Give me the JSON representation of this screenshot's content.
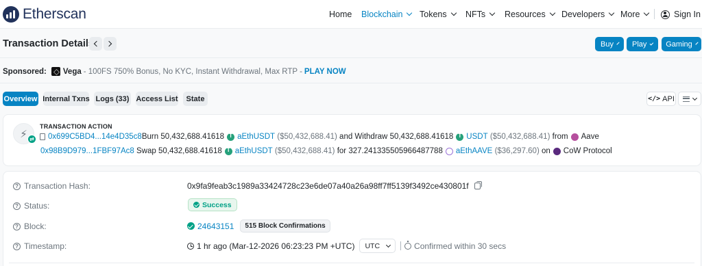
{
  "header": {
    "brand": "Etherscan",
    "nav": [
      {
        "label": "Home",
        "active": false,
        "dropdown": false
      },
      {
        "label": "Blockchain",
        "active": true,
        "dropdown": true
      },
      {
        "label": "Tokens",
        "active": false,
        "dropdown": true
      },
      {
        "label": "NFTs",
        "active": false,
        "dropdown": true
      },
      {
        "label": "Resources",
        "active": false,
        "dropdown": true
      },
      {
        "label": "Developers",
        "active": false,
        "dropdown": true
      },
      {
        "label": "More",
        "active": false,
        "dropdown": true
      }
    ],
    "sign_in": "Sign In"
  },
  "title": "Transaction Details",
  "actions": {
    "buy": "Buy",
    "play": "Play",
    "gaming": "Gaming"
  },
  "sponsored": {
    "label": "Sponsored:",
    "brand": "Vega",
    "text": "- 100FS 750% Bonus, No KYC, Instant Withdrawal, Max RTP -",
    "cta": "PLAY NOW"
  },
  "tabs": [
    {
      "label": "Overview",
      "active": true
    },
    {
      "label": "Internal Txns",
      "active": false
    },
    {
      "label": "Logs (33)",
      "active": false
    },
    {
      "label": "Access List",
      "active": false
    },
    {
      "label": "State",
      "active": false
    }
  ],
  "tools": {
    "api": "API"
  },
  "transaction_action": {
    "title": "TRANSACTION ACTION",
    "line1": {
      "addr": "0x699C5BD4...14e4D35c8",
      "verb1": "Burn",
      "amount1": "50,432,688.41618",
      "token1": "aEthUSDT",
      "usd1": "($50,432,688.41)",
      "mid": "and Withdraw",
      "amount2": "50,432,688.41618",
      "token2": "USDT",
      "usd2": "($50,432,688.41)",
      "from": "from",
      "protocol": "Aave"
    },
    "line2": {
      "addr": "0x98B9D979...1FBF97Ac8",
      "verb": "Swap",
      "amount1": "50,432,688.41618",
      "token1": "aEthUSDT",
      "usd1": "($50,432,688.41)",
      "for": "for",
      "amount2": "327.241335505966487788",
      "token2": "aEthAAVE",
      "usd2": "($36,297.60)",
      "on": "on",
      "protocol": "CoW Protocol"
    }
  },
  "details": {
    "hash_label": "Transaction Hash:",
    "hash": "0x9fa9feab3c1989a33424728c23e6de07a40a26a98ff7ff5139f3492ce430801f",
    "status_label": "Status:",
    "status": "Success",
    "block_label": "Block:",
    "block": "24643151",
    "confirmations": "515 Block Confirmations",
    "timestamp_label": "Timestamp:",
    "timestamp": "1 hr ago (Mar-12-2026 06:23:23 PM +UTC)",
    "tz": "UTC",
    "confirmed": "Confirmed within 30 secs"
  },
  "colors": {
    "accent": "#0784c3",
    "success": "#00a186",
    "brand": "#21325b"
  }
}
